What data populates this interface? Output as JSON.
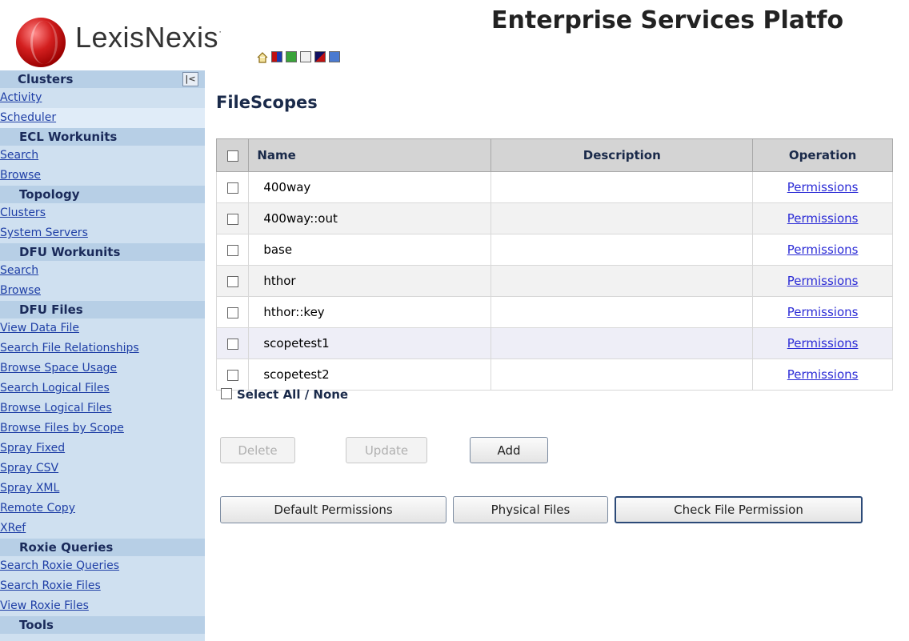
{
  "brand": {
    "name": "LexisNexis",
    "trademark": "·"
  },
  "header": {
    "title": "Enterprise Services Platfo"
  },
  "quick_icons": [
    "home-icon",
    "blocks-icon",
    "refresh-icon",
    "edit-icon",
    "stack-icon",
    "user-icon"
  ],
  "sidebar": {
    "sections": [
      {
        "title": "Clusters",
        "items": [
          "Activity",
          "Scheduler"
        ]
      },
      {
        "title": "ECL Workunits",
        "items": [
          "Search",
          "Browse"
        ]
      },
      {
        "title": "Topology",
        "items": [
          "Clusters",
          "System Servers"
        ]
      },
      {
        "title": "DFU Workunits",
        "items": [
          "Search",
          "Browse"
        ]
      },
      {
        "title": "DFU Files",
        "items": [
          "View Data File",
          "Search File Relationships",
          "Browse Space Usage",
          "Search Logical Files",
          "Browse Logical Files",
          "Browse Files by Scope",
          "Spray Fixed",
          "Spray CSV",
          "Spray XML",
          "Remote Copy",
          "XRef"
        ]
      },
      {
        "title": "Roxie Queries",
        "items": [
          "Search Roxie Queries",
          "Search Roxie Files",
          "View Roxie Files"
        ]
      },
      {
        "title": "Tools",
        "items": []
      }
    ],
    "collapse_label": "|<"
  },
  "main": {
    "title": "FileScopes",
    "columns": {
      "name": "Name",
      "description": "Description",
      "operation": "Operation"
    },
    "rows": [
      {
        "name": "400way",
        "description": "",
        "operation": "Permissions"
      },
      {
        "name": "400way::out",
        "description": "",
        "operation": "Permissions"
      },
      {
        "name": "base",
        "description": "",
        "operation": "Permissions"
      },
      {
        "name": "hthor",
        "description": "",
        "operation": "Permissions"
      },
      {
        "name": "hthor::key",
        "description": "",
        "operation": "Permissions"
      },
      {
        "name": "scopetest1",
        "description": "",
        "operation": "Permissions"
      },
      {
        "name": "scopetest2",
        "description": "",
        "operation": "Permissions"
      }
    ],
    "select_all_label": "Select All / None",
    "buttons": {
      "delete": "Delete",
      "update": "Update",
      "add": "Add",
      "default_permissions": "Default Permissions",
      "physical_files": "Physical Files",
      "check_file_permission": "Check File Permission"
    }
  }
}
